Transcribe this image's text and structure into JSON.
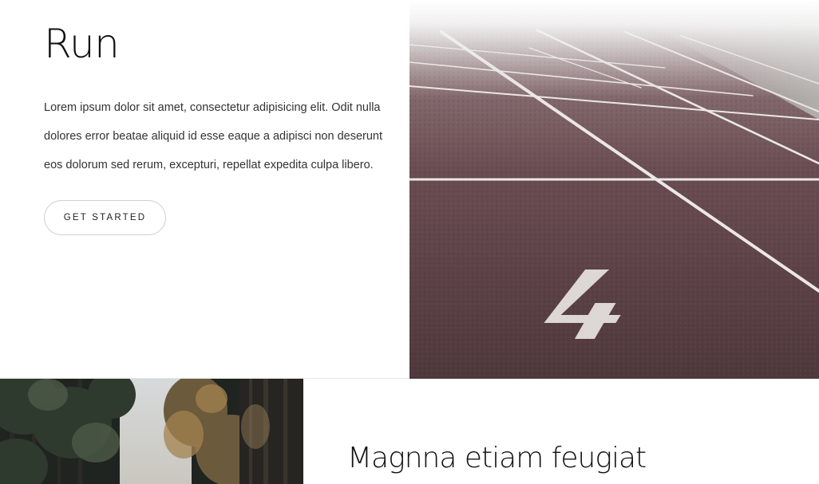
{
  "run_section": {
    "title": "Run",
    "body": "Lorem ipsum dolor sit amet, consectetur adipisicing elit. Odit nulla dolores error beatae aliquid id esse eaque a adipisci non deserunt eos dolorum sed rerum, excepturi, repellat expedita culpa libero.",
    "button_label": "GET STARTED",
    "image": {
      "lane_number": "4"
    }
  },
  "feature_section": {
    "title": "Magnna etiam feugiat"
  },
  "colors": {
    "track": "#5e4246",
    "lane_lines": "#ece7e7",
    "fog": "#f4f4f4",
    "text_dark": "#111111",
    "button_border": "#cfcfcf"
  }
}
